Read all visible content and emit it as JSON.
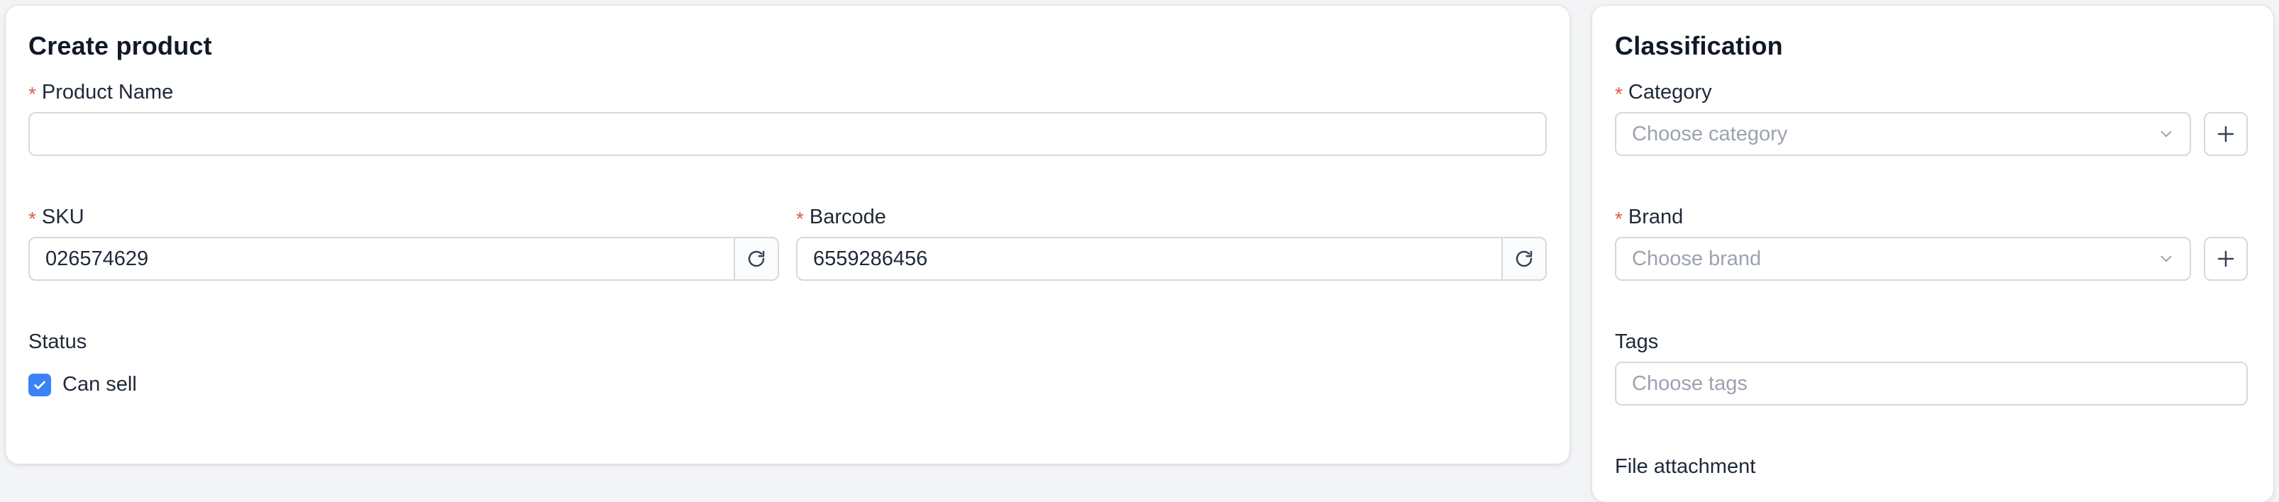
{
  "create_product": {
    "title": "Create product",
    "product_name": {
      "label": "Product Name",
      "value": "",
      "required": true
    },
    "sku": {
      "label": "SKU",
      "value": "026574629",
      "required": true
    },
    "barcode": {
      "label": "Barcode",
      "value": "6559286456",
      "required": true
    },
    "status": {
      "label": "Status",
      "checkbox_label": "Can sell",
      "checked": true
    }
  },
  "classification": {
    "title": "Classification",
    "category": {
      "label": "Category",
      "placeholder": "Choose category",
      "required": true
    },
    "brand": {
      "label": "Brand",
      "placeholder": "Choose brand",
      "required": true
    },
    "tags": {
      "label": "Tags",
      "placeholder": "Choose tags"
    },
    "file_attachment": {
      "label": "File attachment"
    }
  },
  "icons": {
    "refresh": "refresh-icon",
    "chevron": "chevron-down-icon",
    "plus": "plus-icon",
    "check": "check-icon"
  },
  "colors": {
    "accent": "#3b82f6",
    "required": "#e05a47",
    "border": "#d4d8df",
    "placeholder": "#9ca3af"
  }
}
